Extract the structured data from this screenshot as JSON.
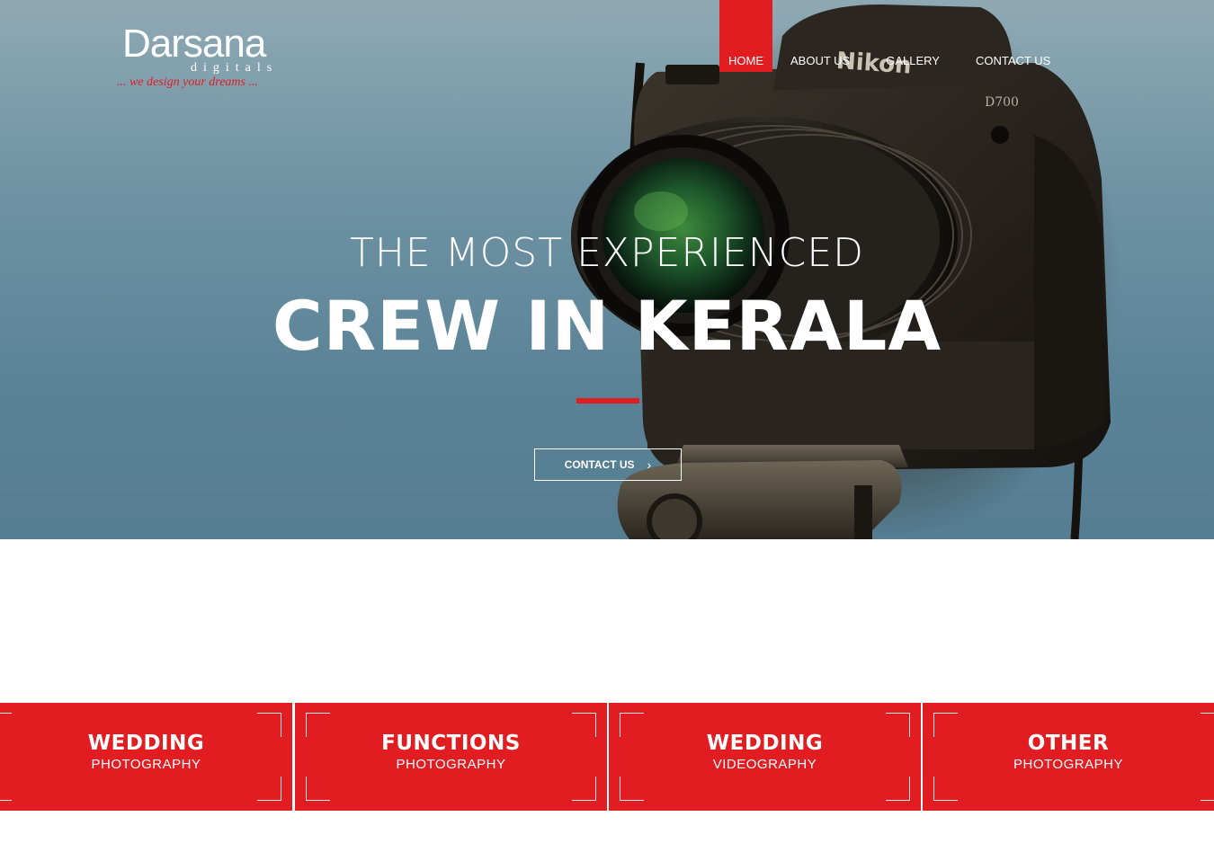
{
  "brand": {
    "name": "Darsana",
    "sub": "digitals",
    "tagline": "... we design your dreams ..."
  },
  "nav": {
    "items": [
      {
        "label": "HOME",
        "active": true
      },
      {
        "label": "ABOUT US",
        "active": false
      },
      {
        "label": "GALLERY",
        "active": false
      },
      {
        "label": "CONTACT US",
        "active": false
      }
    ]
  },
  "hero": {
    "line1": "THE MOST EXPERIENCED",
    "line2": "CREW IN KERALA",
    "button_label": "CONTACT US",
    "button_icon": "chevron-right-icon",
    "camera_brand": "Nikon",
    "camera_model": "D700"
  },
  "services": [
    {
      "title": "WEDDING",
      "subtitle": "PHOTOGRAPHY"
    },
    {
      "title": "FUNCTIONS",
      "subtitle": "PHOTOGRAPHY"
    },
    {
      "title": "WEDDING",
      "subtitle": "VIDEOGRAPHY"
    },
    {
      "title": "OTHER",
      "subtitle": "PHOTOGRAPHY"
    }
  ],
  "colors": {
    "accent": "#e21d22",
    "text_light": "#ffffff"
  }
}
